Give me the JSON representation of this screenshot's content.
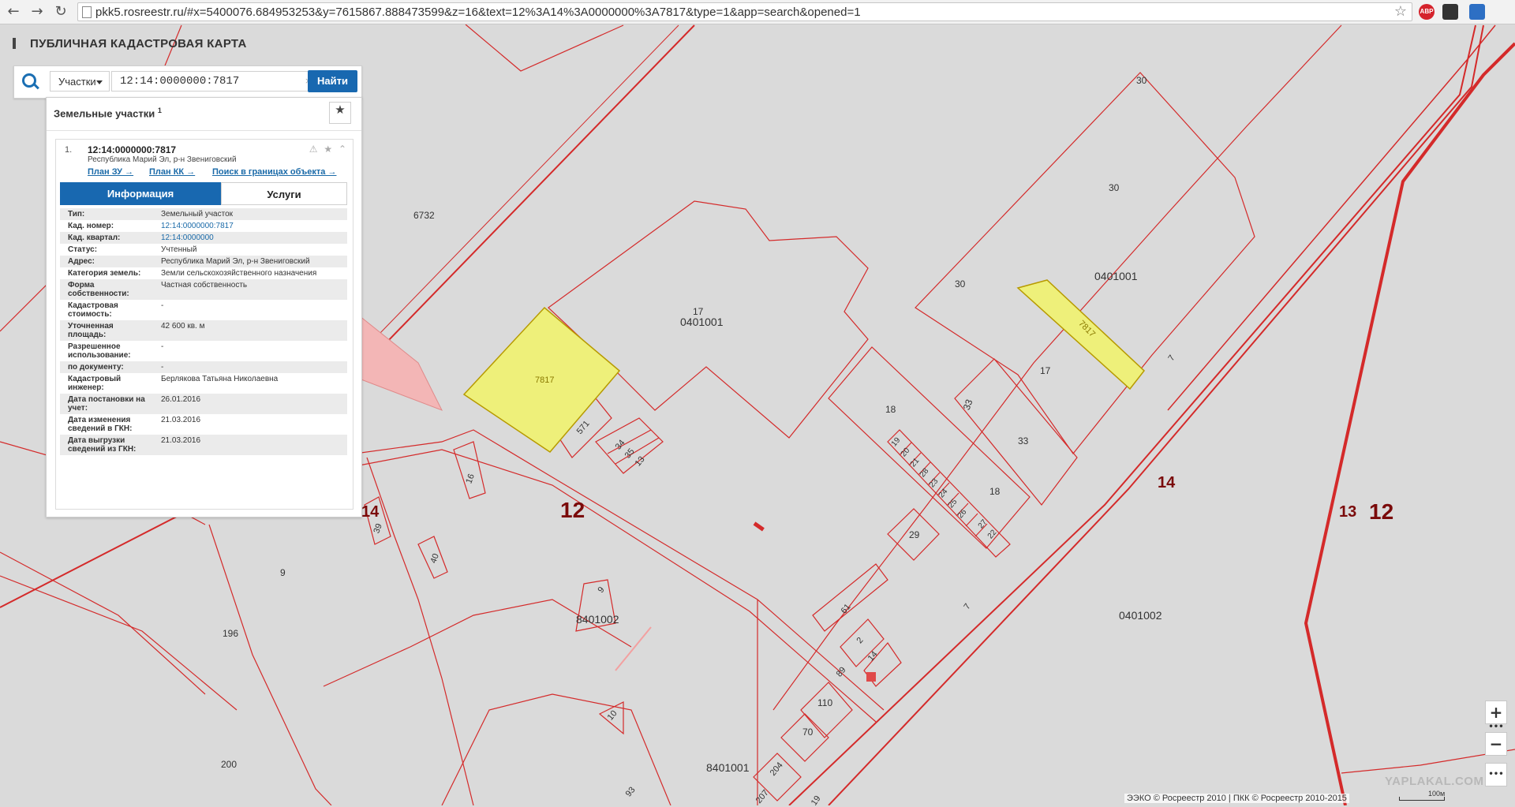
{
  "browser": {
    "url": "pkk5.rosreestr.ru/#x=5400076.684953253&y=7615867.888473599&z=16&text=12%3A14%3A0000000%3A7817&type=1&app=search&opened=1",
    "back_glyph": "←",
    "forward_glyph": "→",
    "reload_glyph": "↻",
    "bookmark_glyph": "☆",
    "ext_abp": "ABP"
  },
  "app": {
    "title": "ПУБЛИЧНАЯ КАДАСТРОВАЯ КАРТА"
  },
  "search": {
    "type_label": "Участки",
    "query": "12:14:0000000:7817",
    "clear_glyph": "×",
    "find_label": "Найти"
  },
  "results": {
    "section_title": "Земельные участки",
    "count": "1",
    "fav_glyph": "★",
    "item": {
      "index": "1.",
      "cad_number": "12:14:0000000:7817",
      "address": "Республика Марий Эл, р-н Звениговский",
      "tools_glyph": "⚠ ★ ⌃",
      "links": [
        "План ЗУ →",
        "План КК →",
        "Поиск в границах объекта →"
      ],
      "tabs": [
        "Информация",
        "Услуги"
      ],
      "info": [
        {
          "key": "Тип:",
          "value": "Земельный участок",
          "link": false
        },
        {
          "key": "Кад. номер:",
          "value": "12:14:0000000:7817",
          "link": true
        },
        {
          "key": "Кад. квартал:",
          "value": "12:14:0000000",
          "link": true
        },
        {
          "key": "Статус:",
          "value": "Учтенный",
          "link": false
        },
        {
          "key": "Адрес:",
          "value": "Республика Марий Эл, р-н Звениговский",
          "link": false
        },
        {
          "key": "Категория земель:",
          "value": "Земли сельскохозяйственного назначения",
          "link": false
        },
        {
          "key": "Форма собственности:",
          "value": "Частная собственность",
          "link": false
        },
        {
          "key": "Кадастровая стоимость:",
          "value": "-",
          "link": false
        },
        {
          "key": "Уточненная площадь:",
          "value": "42 600 кв. м",
          "link": false
        },
        {
          "key": "Разрешенное использование:",
          "value": "-",
          "link": false
        },
        {
          "key": "по документу:",
          "value": "-",
          "link": false
        },
        {
          "key": "Кадастровый инженер:",
          "value": "Берлякова Татьяна Николаевна",
          "link": false
        },
        {
          "key": "Дата постановки на учет:",
          "value": "26.01.2016",
          "link": false
        },
        {
          "key": "Дата изменения сведений в ГКН:",
          "value": "21.03.2016",
          "link": false
        },
        {
          "key": "Дата выгрузки сведений из ГКН:",
          "value": "21.03.2016",
          "link": false
        }
      ]
    }
  },
  "map": {
    "parcel_line_color": "#d42a2a",
    "highlight_fill": "#eef07a",
    "labels": {
      "l6732": "6732",
      "l30a": "30",
      "l30b": "30",
      "l30c": "30",
      "l0401001a": "0401001",
      "l0401001b": "0401001",
      "l17a": "17",
      "l17b": "17",
      "l7817a": "7817",
      "l7817b": "7817",
      "l571": "571",
      "l34": "34",
      "l35": "35",
      "l13": "13",
      "l18a": "18",
      "l18b": "18",
      "l33a": "33",
      "l33b": "33",
      "l19": "19",
      "l20": "20",
      "l21": "21",
      "l28": "28",
      "l23": "23",
      "l24": "24",
      "l25": "25",
      "l26": "26",
      "l27": "27",
      "l22": "22",
      "l29": "29",
      "l16": "16",
      "l39": "39",
      "l9a": "9",
      "l9b": "9",
      "l40": "40",
      "l196": "196",
      "l8401002": "8401002",
      "l0401002": "0401002",
      "l61": "61",
      "l2": "2",
      "l14s": "14",
      "l89": "89",
      "l110": "110",
      "l70": "70",
      "l10": "10",
      "l200": "200",
      "l8401001": "8401001",
      "l204": "204",
      "l207": "207",
      "l93": "93",
      "l7a": "7",
      "l7b": "7",
      "l19b": "19",
      "big12a": "12",
      "big12b": "12",
      "big14a": "14",
      "big14b": "14",
      "big13": "13"
    },
    "zoom_in": "+",
    "zoom_out": "−",
    "more": "•••",
    "attribution": "ЭЭКО © Росреестр 2010 | ПКК © Росреестр 2010-2015",
    "watermark": "YAPLAKAL.COM",
    "scale": "100м"
  }
}
